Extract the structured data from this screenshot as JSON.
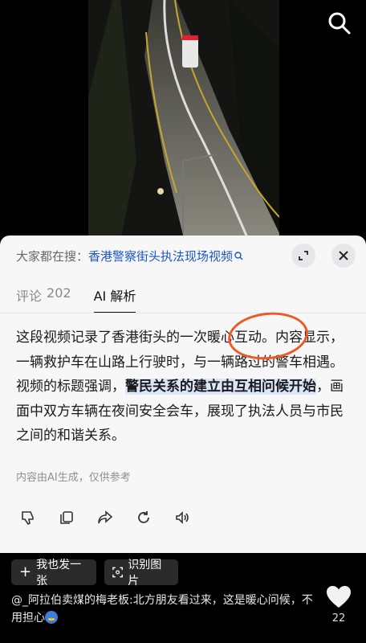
{
  "video": {
    "description_icon": "video-frame",
    "search_icon": "search-icon"
  },
  "ai_sheet": {
    "search_prefix": "大家都在搜：",
    "search_query": "香港警察街头执法现场视频",
    "tabs": [
      {
        "label": "评论",
        "count": "202"
      },
      {
        "label": "AI 解析"
      }
    ],
    "body_parts": {
      "p1": "这段视频记录了香港街头的一次暖心互动。内容显示，一辆救护车在山路上行驶时，与一辆路过的警车相遇。视频的标题强调，",
      "highlight": "警民关系的建立由互相问候开始",
      "p2": "，画面中双方车辆在夜间安全会车，展现了执法人员与市民之间的和谐关系。"
    },
    "disclaimer": "内容由AI生成，仅供参考"
  },
  "bottom": {
    "chip1": "我也发一张",
    "chip2": "识别图片",
    "comment_user": "@_阿拉伯卖煤的梅老板",
    "comment_text": ":北方朋友看过来，这是暖心问候，不用担心",
    "like_count": "22"
  },
  "colors": {
    "accent_link": "#1b56c6",
    "highlight_bg": "#dbe6fb",
    "annotation_ring": "#ee5a25"
  }
}
